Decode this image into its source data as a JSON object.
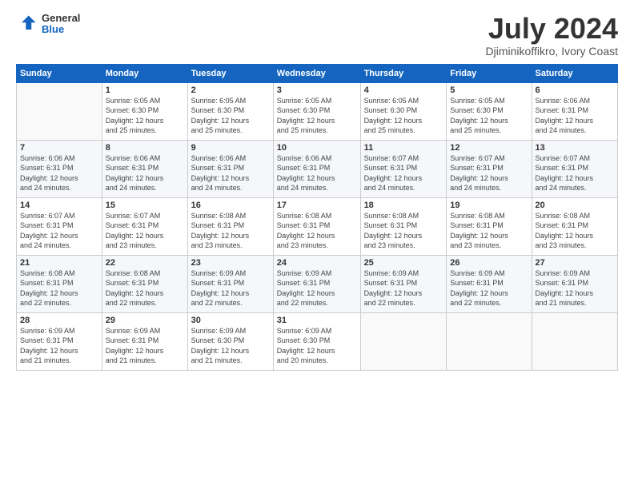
{
  "header": {
    "logo_general": "General",
    "logo_blue": "Blue",
    "title": "July 2024",
    "subtitle": "Djiminikoffikro, Ivory Coast"
  },
  "calendar": {
    "days_of_week": [
      "Sunday",
      "Monday",
      "Tuesday",
      "Wednesday",
      "Thursday",
      "Friday",
      "Saturday"
    ],
    "weeks": [
      [
        {
          "day": "",
          "info": ""
        },
        {
          "day": "1",
          "info": "Sunrise: 6:05 AM\nSunset: 6:30 PM\nDaylight: 12 hours\nand 25 minutes."
        },
        {
          "day": "2",
          "info": "Sunrise: 6:05 AM\nSunset: 6:30 PM\nDaylight: 12 hours\nand 25 minutes."
        },
        {
          "day": "3",
          "info": "Sunrise: 6:05 AM\nSunset: 6:30 PM\nDaylight: 12 hours\nand 25 minutes."
        },
        {
          "day": "4",
          "info": "Sunrise: 6:05 AM\nSunset: 6:30 PM\nDaylight: 12 hours\nand 25 minutes."
        },
        {
          "day": "5",
          "info": "Sunrise: 6:05 AM\nSunset: 6:30 PM\nDaylight: 12 hours\nand 25 minutes."
        },
        {
          "day": "6",
          "info": "Sunrise: 6:06 AM\nSunset: 6:31 PM\nDaylight: 12 hours\nand 24 minutes."
        }
      ],
      [
        {
          "day": "7",
          "info": "Sunrise: 6:06 AM\nSunset: 6:31 PM\nDaylight: 12 hours\nand 24 minutes."
        },
        {
          "day": "8",
          "info": "Sunrise: 6:06 AM\nSunset: 6:31 PM\nDaylight: 12 hours\nand 24 minutes."
        },
        {
          "day": "9",
          "info": "Sunrise: 6:06 AM\nSunset: 6:31 PM\nDaylight: 12 hours\nand 24 minutes."
        },
        {
          "day": "10",
          "info": "Sunrise: 6:06 AM\nSunset: 6:31 PM\nDaylight: 12 hours\nand 24 minutes."
        },
        {
          "day": "11",
          "info": "Sunrise: 6:07 AM\nSunset: 6:31 PM\nDaylight: 12 hours\nand 24 minutes."
        },
        {
          "day": "12",
          "info": "Sunrise: 6:07 AM\nSunset: 6:31 PM\nDaylight: 12 hours\nand 24 minutes."
        },
        {
          "day": "13",
          "info": "Sunrise: 6:07 AM\nSunset: 6:31 PM\nDaylight: 12 hours\nand 24 minutes."
        }
      ],
      [
        {
          "day": "14",
          "info": "Sunrise: 6:07 AM\nSunset: 6:31 PM\nDaylight: 12 hours\nand 24 minutes."
        },
        {
          "day": "15",
          "info": "Sunrise: 6:07 AM\nSunset: 6:31 PM\nDaylight: 12 hours\nand 23 minutes."
        },
        {
          "day": "16",
          "info": "Sunrise: 6:08 AM\nSunset: 6:31 PM\nDaylight: 12 hours\nand 23 minutes."
        },
        {
          "day": "17",
          "info": "Sunrise: 6:08 AM\nSunset: 6:31 PM\nDaylight: 12 hours\nand 23 minutes."
        },
        {
          "day": "18",
          "info": "Sunrise: 6:08 AM\nSunset: 6:31 PM\nDaylight: 12 hours\nand 23 minutes."
        },
        {
          "day": "19",
          "info": "Sunrise: 6:08 AM\nSunset: 6:31 PM\nDaylight: 12 hours\nand 23 minutes."
        },
        {
          "day": "20",
          "info": "Sunrise: 6:08 AM\nSunset: 6:31 PM\nDaylight: 12 hours\nand 23 minutes."
        }
      ],
      [
        {
          "day": "21",
          "info": "Sunrise: 6:08 AM\nSunset: 6:31 PM\nDaylight: 12 hours\nand 22 minutes."
        },
        {
          "day": "22",
          "info": "Sunrise: 6:08 AM\nSunset: 6:31 PM\nDaylight: 12 hours\nand 22 minutes."
        },
        {
          "day": "23",
          "info": "Sunrise: 6:09 AM\nSunset: 6:31 PM\nDaylight: 12 hours\nand 22 minutes."
        },
        {
          "day": "24",
          "info": "Sunrise: 6:09 AM\nSunset: 6:31 PM\nDaylight: 12 hours\nand 22 minutes."
        },
        {
          "day": "25",
          "info": "Sunrise: 6:09 AM\nSunset: 6:31 PM\nDaylight: 12 hours\nand 22 minutes."
        },
        {
          "day": "26",
          "info": "Sunrise: 6:09 AM\nSunset: 6:31 PM\nDaylight: 12 hours\nand 22 minutes."
        },
        {
          "day": "27",
          "info": "Sunrise: 6:09 AM\nSunset: 6:31 PM\nDaylight: 12 hours\nand 21 minutes."
        }
      ],
      [
        {
          "day": "28",
          "info": "Sunrise: 6:09 AM\nSunset: 6:31 PM\nDaylight: 12 hours\nand 21 minutes."
        },
        {
          "day": "29",
          "info": "Sunrise: 6:09 AM\nSunset: 6:31 PM\nDaylight: 12 hours\nand 21 minutes."
        },
        {
          "day": "30",
          "info": "Sunrise: 6:09 AM\nSunset: 6:30 PM\nDaylight: 12 hours\nand 21 minutes."
        },
        {
          "day": "31",
          "info": "Sunrise: 6:09 AM\nSunset: 6:30 PM\nDaylight: 12 hours\nand 20 minutes."
        },
        {
          "day": "",
          "info": ""
        },
        {
          "day": "",
          "info": ""
        },
        {
          "day": "",
          "info": ""
        }
      ]
    ]
  }
}
